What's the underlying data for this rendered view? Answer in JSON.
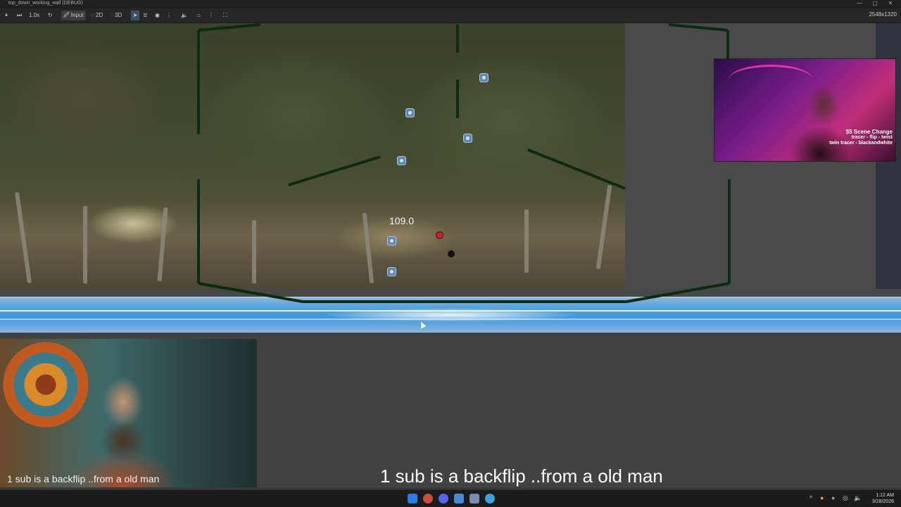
{
  "window": {
    "title": "top_down_working_wall (DEBUG)",
    "controls": [
      "—",
      "▢",
      "✕"
    ]
  },
  "toolbar": {
    "zoom": "1.0x",
    "input_label": "Input",
    "mode_2d": "2D",
    "mode_3d": "3D",
    "resolution": "2548x1320"
  },
  "game": {
    "score": "109.0"
  },
  "stream": {
    "right_overlay_lines": [
      "$5 Scene Change",
      "tracer - flip - twist",
      "twin tracer - blackandwhite"
    ],
    "left_caption": "1 sub is a backflip ..from a old man",
    "subtitle": "1 sub is a backflip ..from a old man"
  },
  "taskbar": {
    "time": "1:12 AM",
    "date": "3/28/2026"
  },
  "colors": {
    "accent": "#3f97de",
    "wall_line": "#0d2a12",
    "toolbar_bg": "#262626"
  }
}
